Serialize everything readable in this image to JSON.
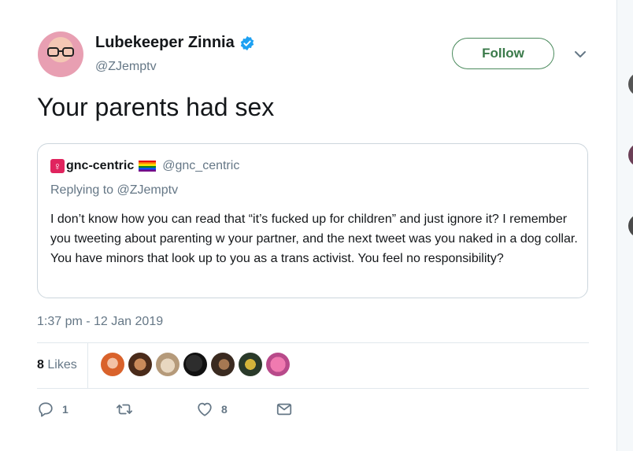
{
  "tweet": {
    "display_name": "Lubekeeper Zinnia",
    "handle": "@ZJemptv",
    "follow_label": "Follow",
    "text": "Your parents had sex",
    "timestamp": "1:37 pm - 12 Jan 2019",
    "likes_number": "8",
    "likes_word": "Likes",
    "reply_count": "1",
    "retweet_count": "",
    "like_count": "8"
  },
  "quote": {
    "venus_symbol": "♀",
    "display_name": "gnc-centric",
    "handle": "@gnc_centric",
    "replying_to": "Replying to @ZJemptv",
    "body": "I don’t know how you can read that “it’s fucked up for children” and just ignore it? I remember you tweeting about parenting w your partner, and the next tweet was you naked in a dog collar. You have minors that look up to you as a trans activist. You feel no responsibility?"
  },
  "colors": {
    "verified": "#1da1f2",
    "follow_border": "#4a8a5c",
    "secondary_text": "#657786"
  },
  "icons": [
    "verified-badge-icon",
    "chevron-down-icon",
    "reply-icon",
    "retweet-icon",
    "heart-icon",
    "envelope-icon",
    "rainbow-flag-icon",
    "venus-icon"
  ]
}
